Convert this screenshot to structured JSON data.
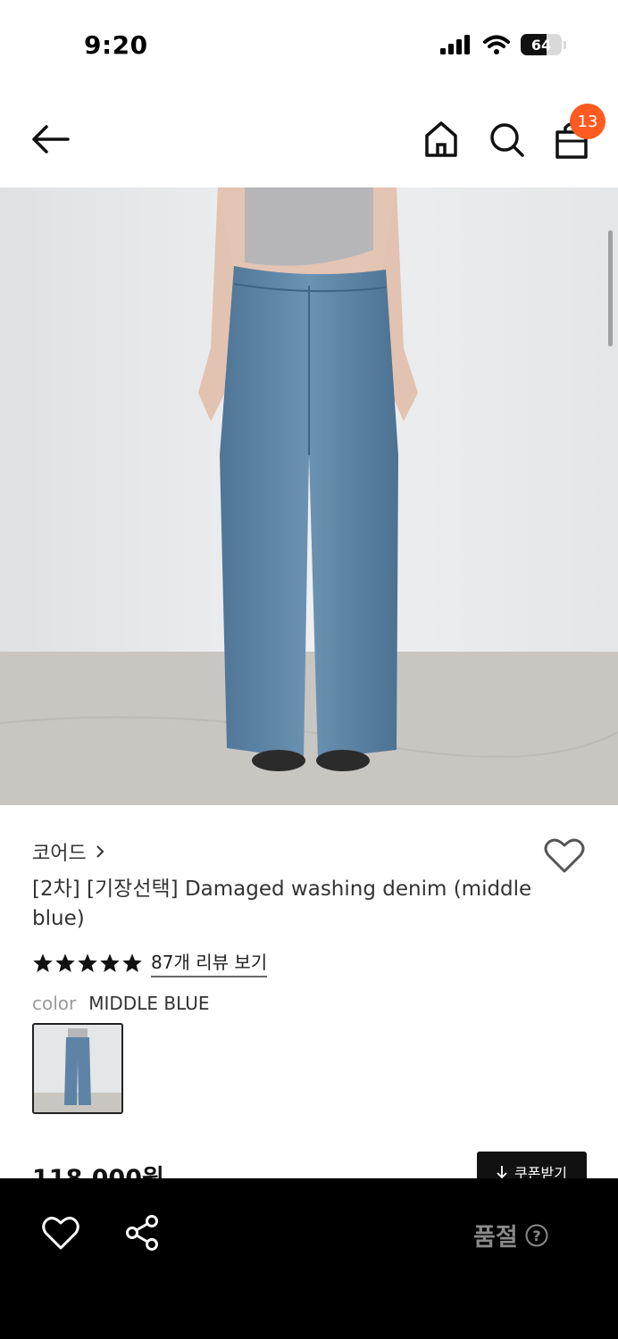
{
  "status_bar": {
    "time": "9:20",
    "battery": "64",
    "battery_level": 0.64
  },
  "header": {
    "cart_count": "13"
  },
  "product": {
    "brand": "코어드",
    "title": "[2차] [기장선택] Damaged washing denim (middle blue)",
    "rating_stars": 5,
    "review_link": "87개 리뷰 보기",
    "color_label": "color",
    "color_value": "MIDDLE BLUE",
    "price": "118,000원",
    "coupon_button": "쿠폰받기"
  },
  "bottom_bar": {
    "status": "품절"
  },
  "icons": [
    "back-arrow-icon",
    "home-icon",
    "search-icon",
    "bag-icon",
    "heart-icon",
    "star-icon",
    "share-icon",
    "question-icon",
    "chevron-right-icon",
    "download-arrow-icon"
  ],
  "colors": {
    "accent": "#ff5a1f",
    "bottom_bar": "#000000",
    "denim": "#5d84a6"
  }
}
